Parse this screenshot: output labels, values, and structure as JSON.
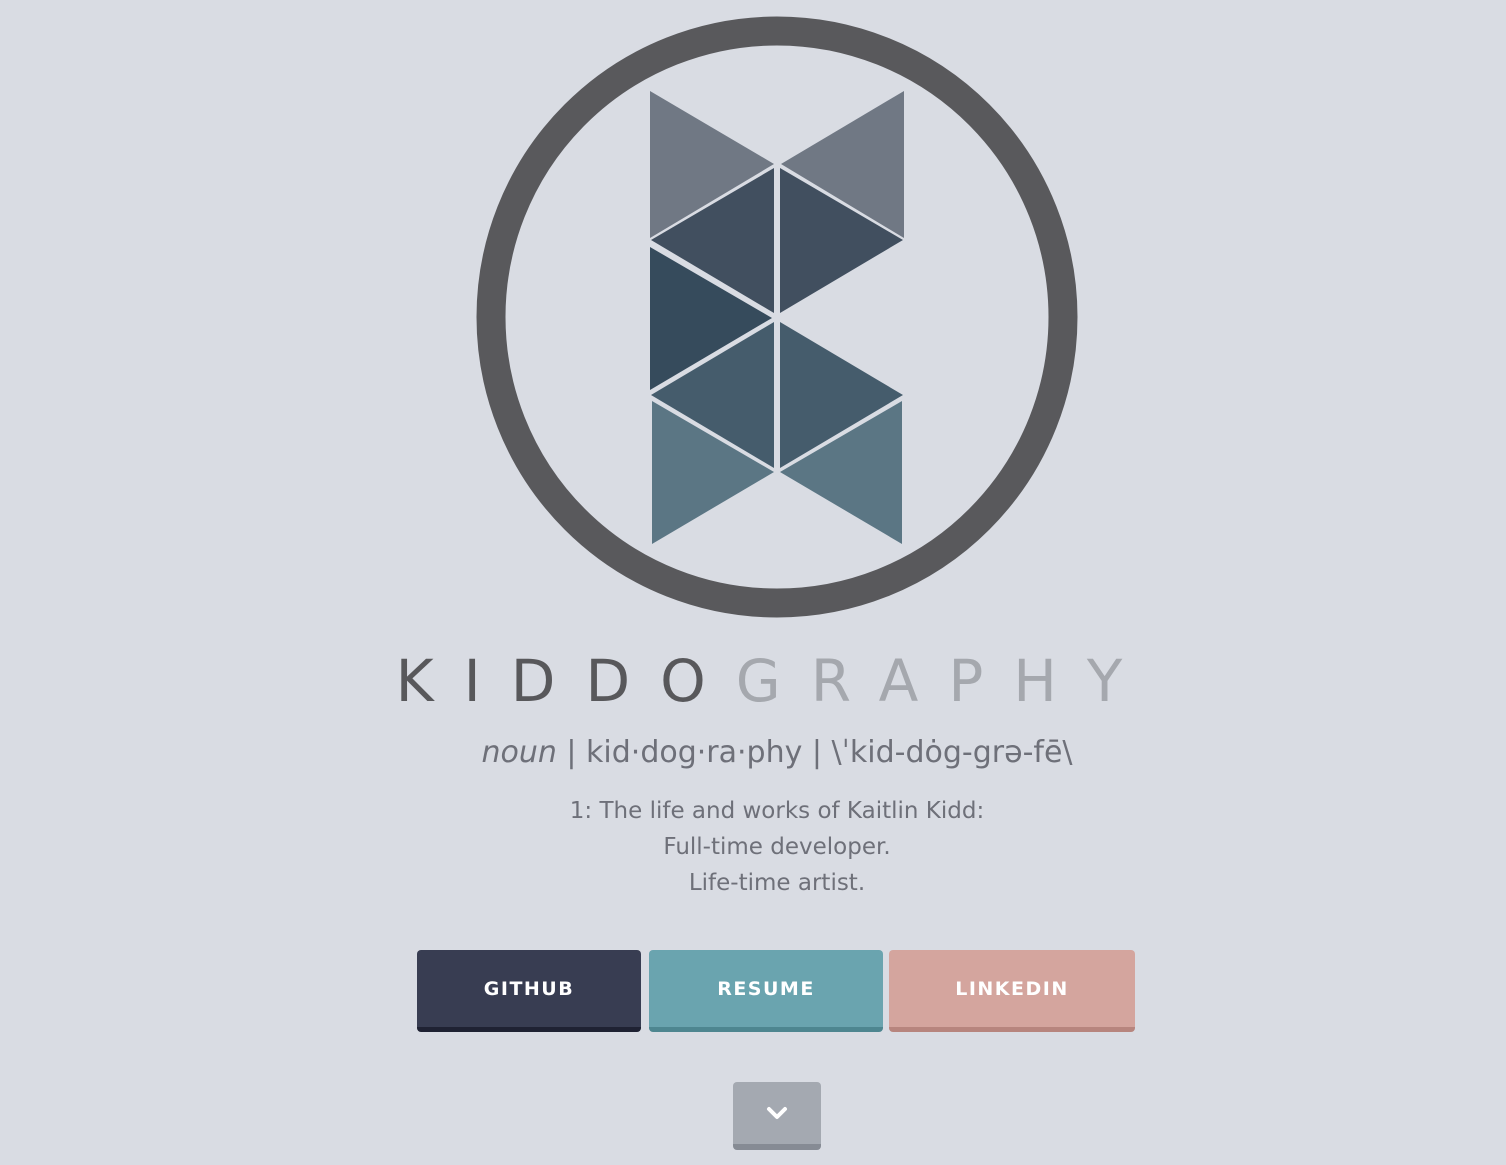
{
  "logo": {
    "icon": "kiddography-logo-icon",
    "ring_color": "#59595c",
    "triangle_colors": [
      "#707884",
      "#414f5f",
      "#364b5c",
      "#455c6c",
      "#5b7684"
    ]
  },
  "title": {
    "part1": "KIDDO",
    "part2": "GRAPHY",
    "color_part1": "#58585b",
    "color_part2": "#a5a8ae"
  },
  "pronunciation": {
    "part_of_speech": "noun",
    "text": " | kid·dog·ra·phy | \\ˈkid-dȯg-grə-fē\\"
  },
  "definition": {
    "line1": "1: The life and works of Kaitlin Kidd:",
    "line2": "Full-time developer.",
    "line3": "Life-time artist."
  },
  "buttons": {
    "github": "GITHUB",
    "resume": "RESUME",
    "linkedin": "LINKEDIN"
  },
  "scroll": {
    "icon": "chevron-down-icon"
  },
  "colors": {
    "background": "#d9dce3",
    "github": "#383d52",
    "resume": "#6aa4af",
    "linkedin": "#d4a59e",
    "scroll": "#a4a9b1"
  }
}
